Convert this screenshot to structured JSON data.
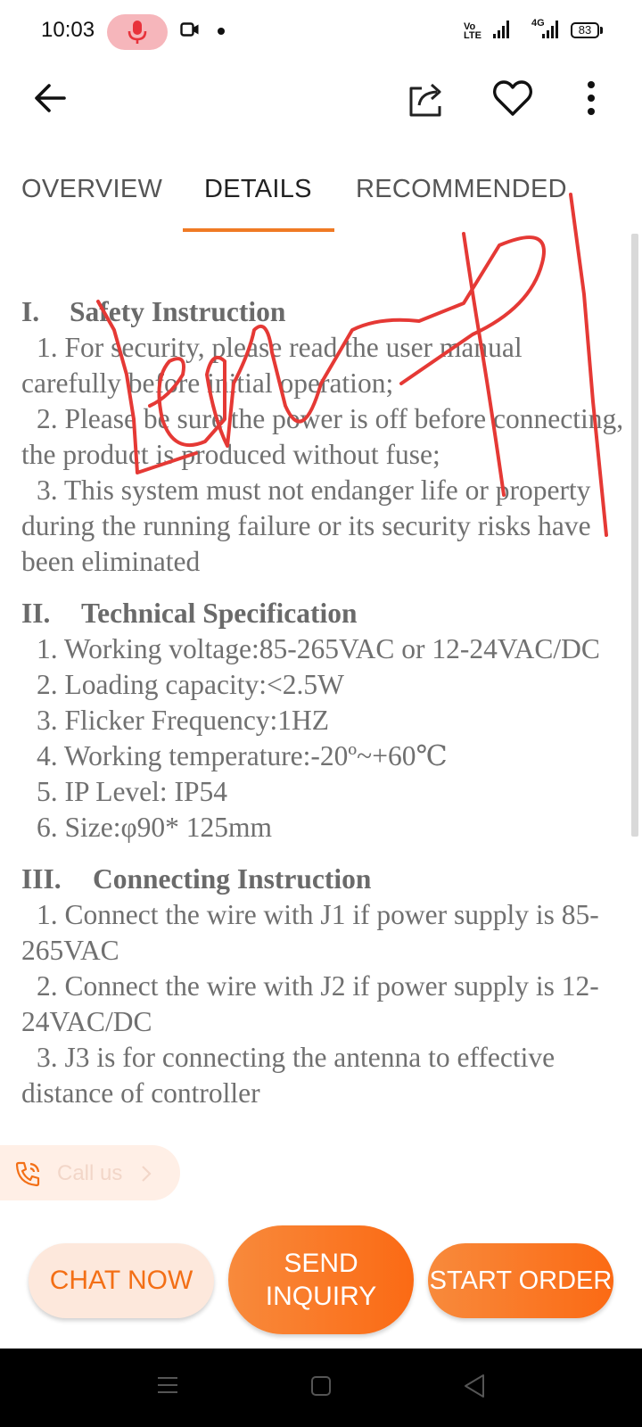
{
  "status_bar": {
    "time": "10:03",
    "volte_label": "Vo\nLTE",
    "network_label": "4G",
    "battery": "83"
  },
  "top_bar": {
    "icons": [
      "back-arrow-icon",
      "share-icon",
      "heart-icon",
      "more-vert-icon"
    ]
  },
  "tabs": [
    {
      "label": "OVERVIEW",
      "active": false
    },
    {
      "label": "DETAILS",
      "active": true
    },
    {
      "label": "RECOMMENDED",
      "active": false
    }
  ],
  "accent_color": "#f07a24",
  "details": {
    "section1": {
      "roman": "I.",
      "title": "Safety Instruction",
      "items": [
        "1. For security, please read the user manual carefully before initial operation;",
        "2. Please be sure the power is off before connecting, the product is produced without fuse;",
        "3. This system must not endanger life or property during the running failure or its security risks have been eliminated"
      ]
    },
    "section2": {
      "roman": "II.",
      "title": "Technical Specification",
      "items": [
        "1. Working voltage:85-265VAC or 12-24VAC/DC",
        "2. Loading capacity:<2.5W",
        "3. Flicker Frequency:1HZ",
        "4. Working temperature:-20º~+60℃",
        "5. IP Level: IP54",
        "6. Size:φ90* 125mm"
      ]
    },
    "section3": {
      "roman": "III.",
      "title": "Connecting Instruction",
      "items": [
        "1. Connect the wire with J1 if power supply is 85-265VAC",
        "2. Connect the wire with J2 if power supply is 12-24VAC/DC",
        "3. J3 is for connecting the antenna to effective distance of controller"
      ]
    }
  },
  "call_us": {
    "label": "Call us"
  },
  "actions": {
    "chat_now": "CHAT NOW",
    "send_inquiry": "SEND INQUIRY",
    "start_order": "START ORDER"
  }
}
